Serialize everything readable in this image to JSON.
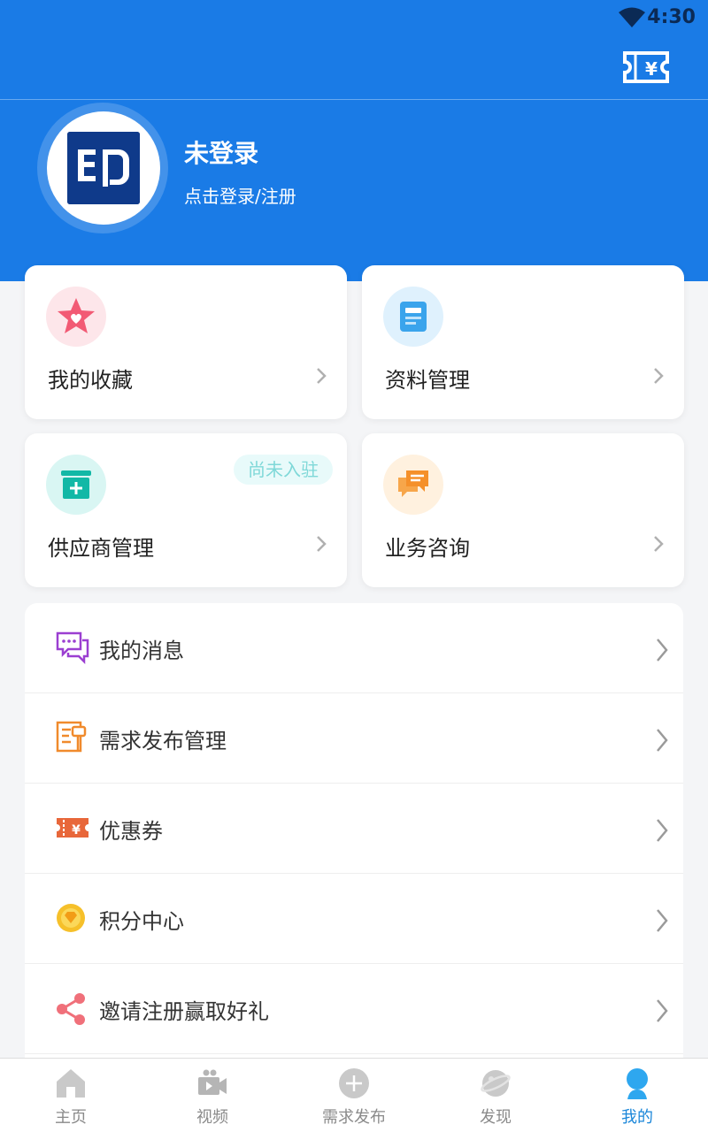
{
  "status_bar": {
    "time": "4:30"
  },
  "profile": {
    "name": "未登录",
    "subtitle": "点击登录/注册"
  },
  "cards": [
    {
      "label": "我的收藏",
      "icon": "star-heart-icon"
    },
    {
      "label": "资料管理",
      "icon": "document-icon"
    },
    {
      "label": "供应商管理",
      "icon": "store-add-icon",
      "badge": "尚未入驻"
    },
    {
      "label": "业务咨询",
      "icon": "chat-icon"
    }
  ],
  "menu": [
    {
      "label": "我的消息",
      "icon": "message-icon"
    },
    {
      "label": "需求发布管理",
      "icon": "demand-icon"
    },
    {
      "label": "优惠券",
      "icon": "coupon-icon"
    },
    {
      "label": "积分中心",
      "icon": "points-icon"
    },
    {
      "label": "邀请注册赢取好礼",
      "icon": "share-icon"
    }
  ],
  "tabs": [
    {
      "label": "主页",
      "icon": "home-icon"
    },
    {
      "label": "视频",
      "icon": "video-icon"
    },
    {
      "label": "需求发布",
      "icon": "plus-icon"
    },
    {
      "label": "发现",
      "icon": "planet-icon"
    },
    {
      "label": "我的",
      "icon": "person-icon",
      "active": true
    }
  ],
  "colors": {
    "primary": "#1a7be6",
    "active_tab": "#1a86d9"
  }
}
